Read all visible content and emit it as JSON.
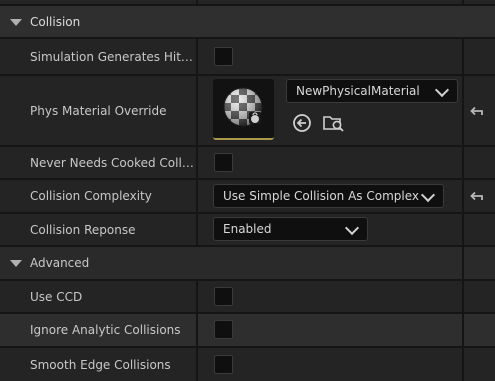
{
  "collision": {
    "header": "Collision",
    "sim_hit_events": {
      "label": "Simulation Generates Hit Events",
      "checked": false
    },
    "phys_material": {
      "label": "Phys Material Override",
      "value": "NewPhysicalMaterial"
    },
    "never_cooked": {
      "label": "Never Needs Cooked Collision Data",
      "checked": false
    },
    "complexity": {
      "label": "Collision Complexity",
      "value": "Use Simple Collision As Complex"
    },
    "response": {
      "label": "Collision Reponse",
      "value": "Enabled"
    }
  },
  "advanced": {
    "header": "Advanced",
    "use_ccd": {
      "label": "Use CCD",
      "checked": false
    },
    "ignore_analytic": {
      "label": "Ignore Analytic Collisions",
      "checked": false
    },
    "smooth_edge": {
      "label": "Smooth Edge Collisions",
      "checked": false
    }
  },
  "icons": {
    "section_toggle": "triangle-down-icon",
    "dropdown": "chevron-down-icon",
    "reset": "reset-to-default-icon",
    "use_selected": "arrow-left-circle-icon",
    "browse": "folder-search-icon",
    "asset_thumbnail": "physical-material-thumbnail"
  },
  "colors": {
    "panel_bg": "#242424",
    "header_bg": "#2f2f2f",
    "field_bg": "#0f0f0f",
    "thumbnail_underline": "#a89a4a"
  }
}
